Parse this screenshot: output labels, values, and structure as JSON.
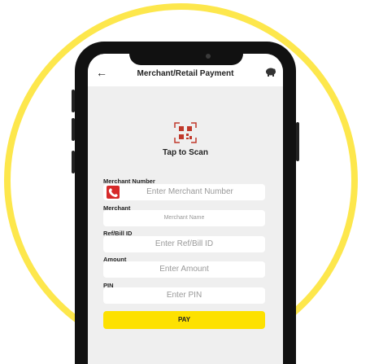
{
  "header": {
    "title": "Merchant/Retail Payment"
  },
  "scan": {
    "label": "Tap to Scan"
  },
  "form": {
    "merchant_number_label": "Merchant Number",
    "merchant_number_placeholder": "Enter Merchant Number",
    "merchant_label": "Merchant",
    "merchant_placeholder": "Merchant Name",
    "ref_label": "Ref/Bill ID",
    "ref_placeholder": "Enter Ref/Bill ID",
    "amount_label": "Amount",
    "amount_placeholder": "Enter Amount",
    "pin_label": "PIN",
    "pin_placeholder": "Enter PIN",
    "pay_label": "PAY"
  },
  "icons": {
    "back": "back-arrow-icon",
    "piggy": "piggy-bank-icon",
    "qr": "qr-code-icon",
    "phone": "phone-icon"
  },
  "colors": {
    "accent_yellow": "#fde100",
    "ring_yellow": "#fde74c",
    "phone_red": "#d62a2a"
  }
}
